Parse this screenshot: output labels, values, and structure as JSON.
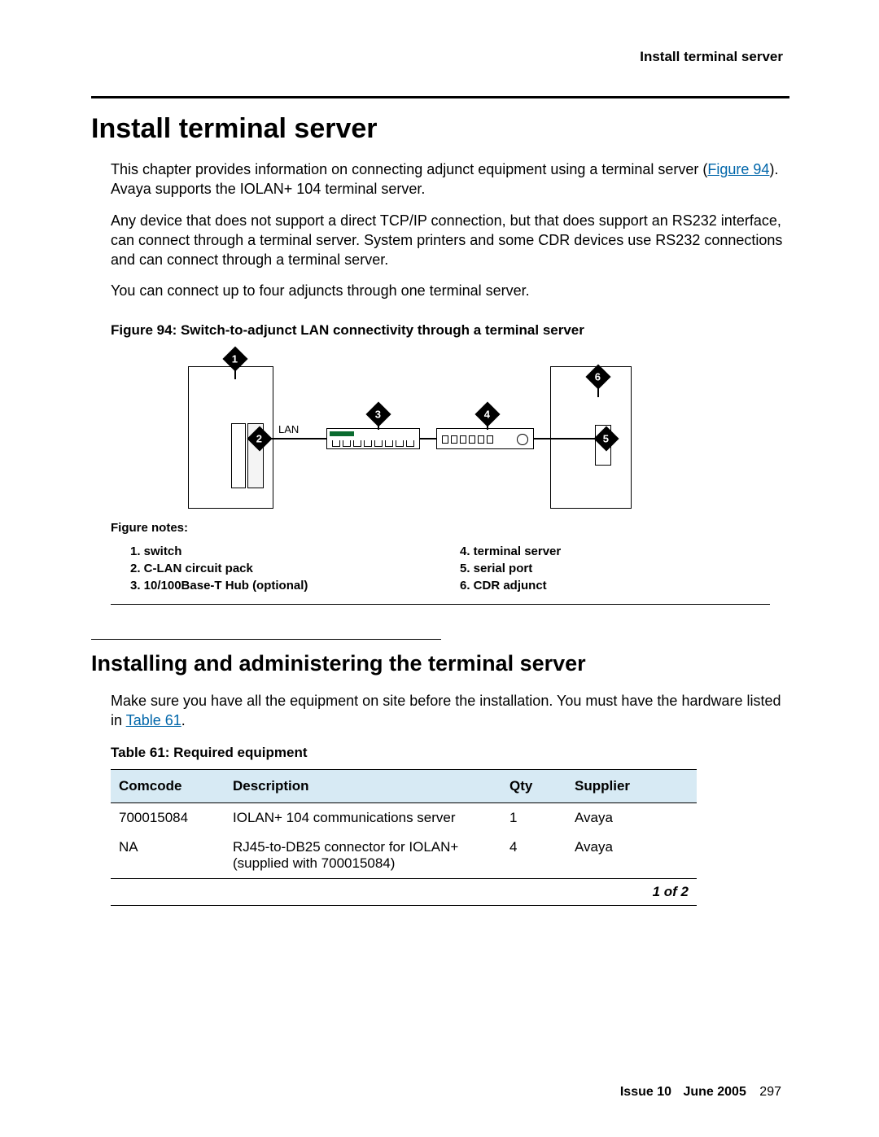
{
  "header": {
    "running_head": "Install terminal server"
  },
  "title": "Install terminal server",
  "paragraphs": {
    "p1a": "This chapter provides information on connecting adjunct equipment using a terminal server (",
    "p1_link": "Figure 94",
    "p1b": ". Avaya supports the IOLAN+ 104 terminal server.",
    "p2": "Any device that does not support a direct TCP/IP connection, but that does support an RS232 interface, can connect through a terminal server. System printers and some CDR devices use RS232 connections and can connect through a terminal server.",
    "p3": "You can connect up to four adjuncts through one terminal server."
  },
  "figure": {
    "caption": "Figure 94: Switch-to-adjunct LAN connectivity through a terminal server",
    "lan_label": "LAN",
    "notes_label": "Figure notes:",
    "callouts": {
      "1": "1",
      "2": "2",
      "3": "3",
      "4": "4",
      "5": "5",
      "6": "6"
    },
    "notes_left": [
      "1.  switch",
      "2.  C-LAN circuit pack",
      "3.  10/100Base-T Hub (optional)"
    ],
    "notes_right": [
      "4.  terminal server",
      "5.  serial port",
      "6.  CDR adjunct"
    ]
  },
  "section2": {
    "title": "Installing and administering the terminal server",
    "p_a": "Make sure you have all the equipment on site before the installation. You must have the hardware listed in ",
    "p_link": "Table 61",
    "p_b": "."
  },
  "table": {
    "caption": "Table 61: Required equipment",
    "headers": {
      "c1": "Comcode",
      "c2": "Description",
      "c3": "Qty",
      "c4": "Supplier"
    },
    "rows": [
      {
        "comcode": "700015084",
        "desc": "IOLAN+ 104 communications server",
        "qty": "1",
        "supplier": "Avaya"
      },
      {
        "comcode": "NA",
        "desc": "RJ45-to-DB25 connector for IOLAN+ (supplied with 700015084)",
        "qty": "4",
        "supplier": "Avaya"
      }
    ],
    "pager": "1 of 2"
  },
  "footer": {
    "issue": "Issue 10",
    "date": "June 2005",
    "page": "297"
  }
}
